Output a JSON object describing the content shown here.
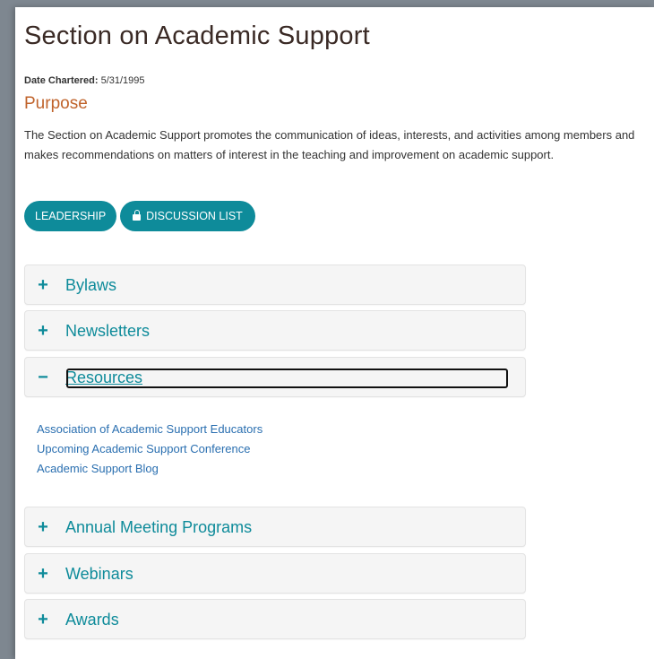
{
  "page": {
    "title": "Section on Academic Support",
    "chartered_label": "Date Chartered:",
    "chartered_value": "5/31/1995",
    "purpose_heading": "Purpose",
    "purpose_text": "The Section on Academic Support promotes the communication of ideas, interests, and activities among members and makes recommendations on matters of interest in the teaching and improvement on academic support."
  },
  "buttons": {
    "leadership": "LEADERSHIP",
    "discussion": "DISCUSSION LIST"
  },
  "accordion": {
    "bylaws": {
      "sign": "+",
      "title": "Bylaws"
    },
    "newsletters": {
      "sign": "+",
      "title": "Newsletters"
    },
    "resources": {
      "sign": "−",
      "title": "Resources",
      "links": [
        "Association of Academic Support Educators",
        "Upcoming Academic Support Conference",
        "Academic Support Blog"
      ]
    },
    "annual": {
      "sign": "+",
      "title": "Annual Meeting Programs"
    },
    "webinars": {
      "sign": "+",
      "title": "Webinars"
    },
    "awards": {
      "sign": "+",
      "title": "Awards"
    }
  },
  "colors": {
    "accent": "#0e8b9a",
    "heading": "#c0632b",
    "link": "#2a6fb0"
  },
  "icons": {
    "discussion_button": "lock-icon"
  }
}
